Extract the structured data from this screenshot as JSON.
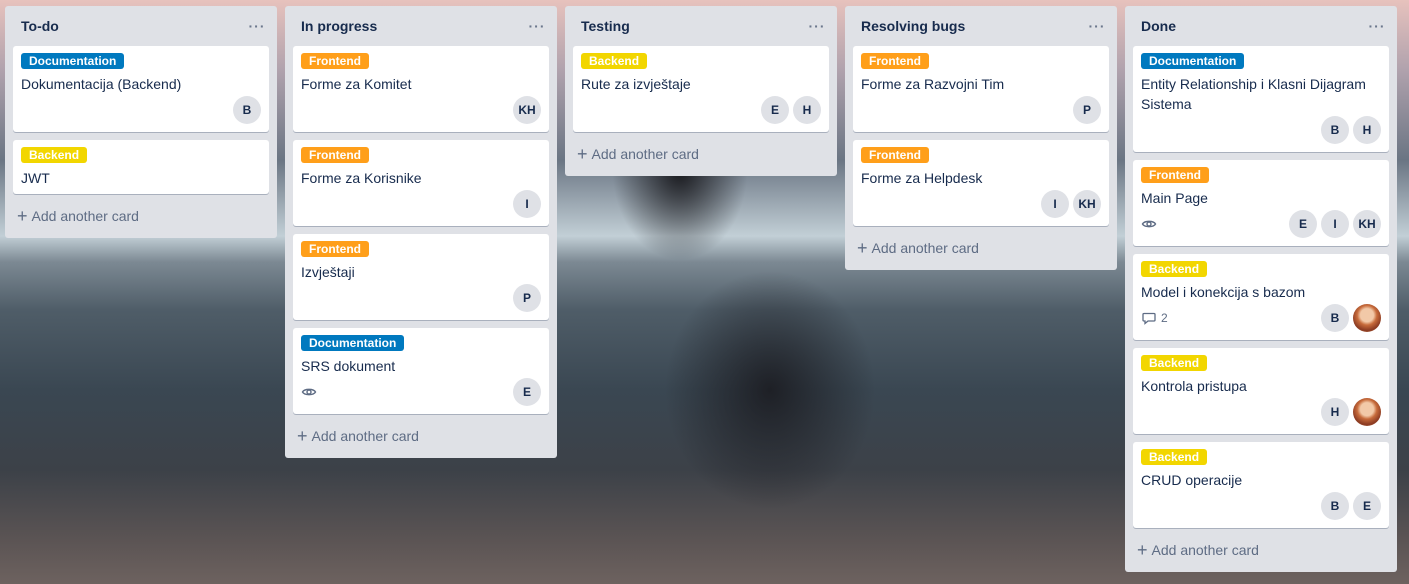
{
  "board": {
    "add_card_label": "Add another card",
    "menu_glyph": "···",
    "colors": {
      "Documentation": "#0079bf",
      "Frontend": "#ff9f1a",
      "Backend": "#f2d600",
      "list_bg": "#dfe1e6"
    },
    "lists": [
      {
        "title": "To-do",
        "cards": [
          {
            "label": "Documentation",
            "title": "Dokumentacija (Backend)",
            "members": [
              "B"
            ]
          },
          {
            "label": "Backend",
            "title": "JWT",
            "members": []
          }
        ]
      },
      {
        "title": "In progress",
        "cards": [
          {
            "label": "Frontend",
            "title": "Forme za Komitet",
            "members": [
              "KH"
            ]
          },
          {
            "label": "Frontend",
            "title": "Forme za Korisnike",
            "members": [
              "I"
            ]
          },
          {
            "label": "Frontend",
            "title": "Izvještaji",
            "members": [
              "P"
            ]
          },
          {
            "label": "Documentation",
            "title": "SRS dokument",
            "watch": true,
            "members": [
              "E"
            ]
          }
        ]
      },
      {
        "title": "Testing",
        "cards": [
          {
            "label": "Backend",
            "title": "Rute za izvještaje",
            "members": [
              "E",
              "H"
            ]
          }
        ]
      },
      {
        "title": "Resolving bugs",
        "cards": [
          {
            "label": "Frontend",
            "title": "Forme za Razvojni Tim",
            "members": [
              "P"
            ]
          },
          {
            "label": "Frontend",
            "title": "Forme za Helpdesk",
            "members": [
              "I",
              "KH"
            ]
          }
        ]
      },
      {
        "title": "Done",
        "cards": [
          {
            "label": "Documentation",
            "title": "Entity Relationship i Klasni Dijagram Sistema",
            "members": [
              "B",
              "H"
            ]
          },
          {
            "label": "Frontend",
            "title": "Main Page",
            "watch": true,
            "members": [
              "E",
              "I",
              "KH"
            ]
          },
          {
            "label": "Backend",
            "title": "Model i konekcija s bazom",
            "comments": "2",
            "members": [
              "B",
              "photo"
            ]
          },
          {
            "label": "Backend",
            "title": "Kontrola pristupa",
            "members": [
              "H",
              "photo"
            ]
          },
          {
            "label": "Backend",
            "title": "CRUD operacije",
            "members": [
              "B",
              "E"
            ]
          }
        ]
      }
    ]
  }
}
